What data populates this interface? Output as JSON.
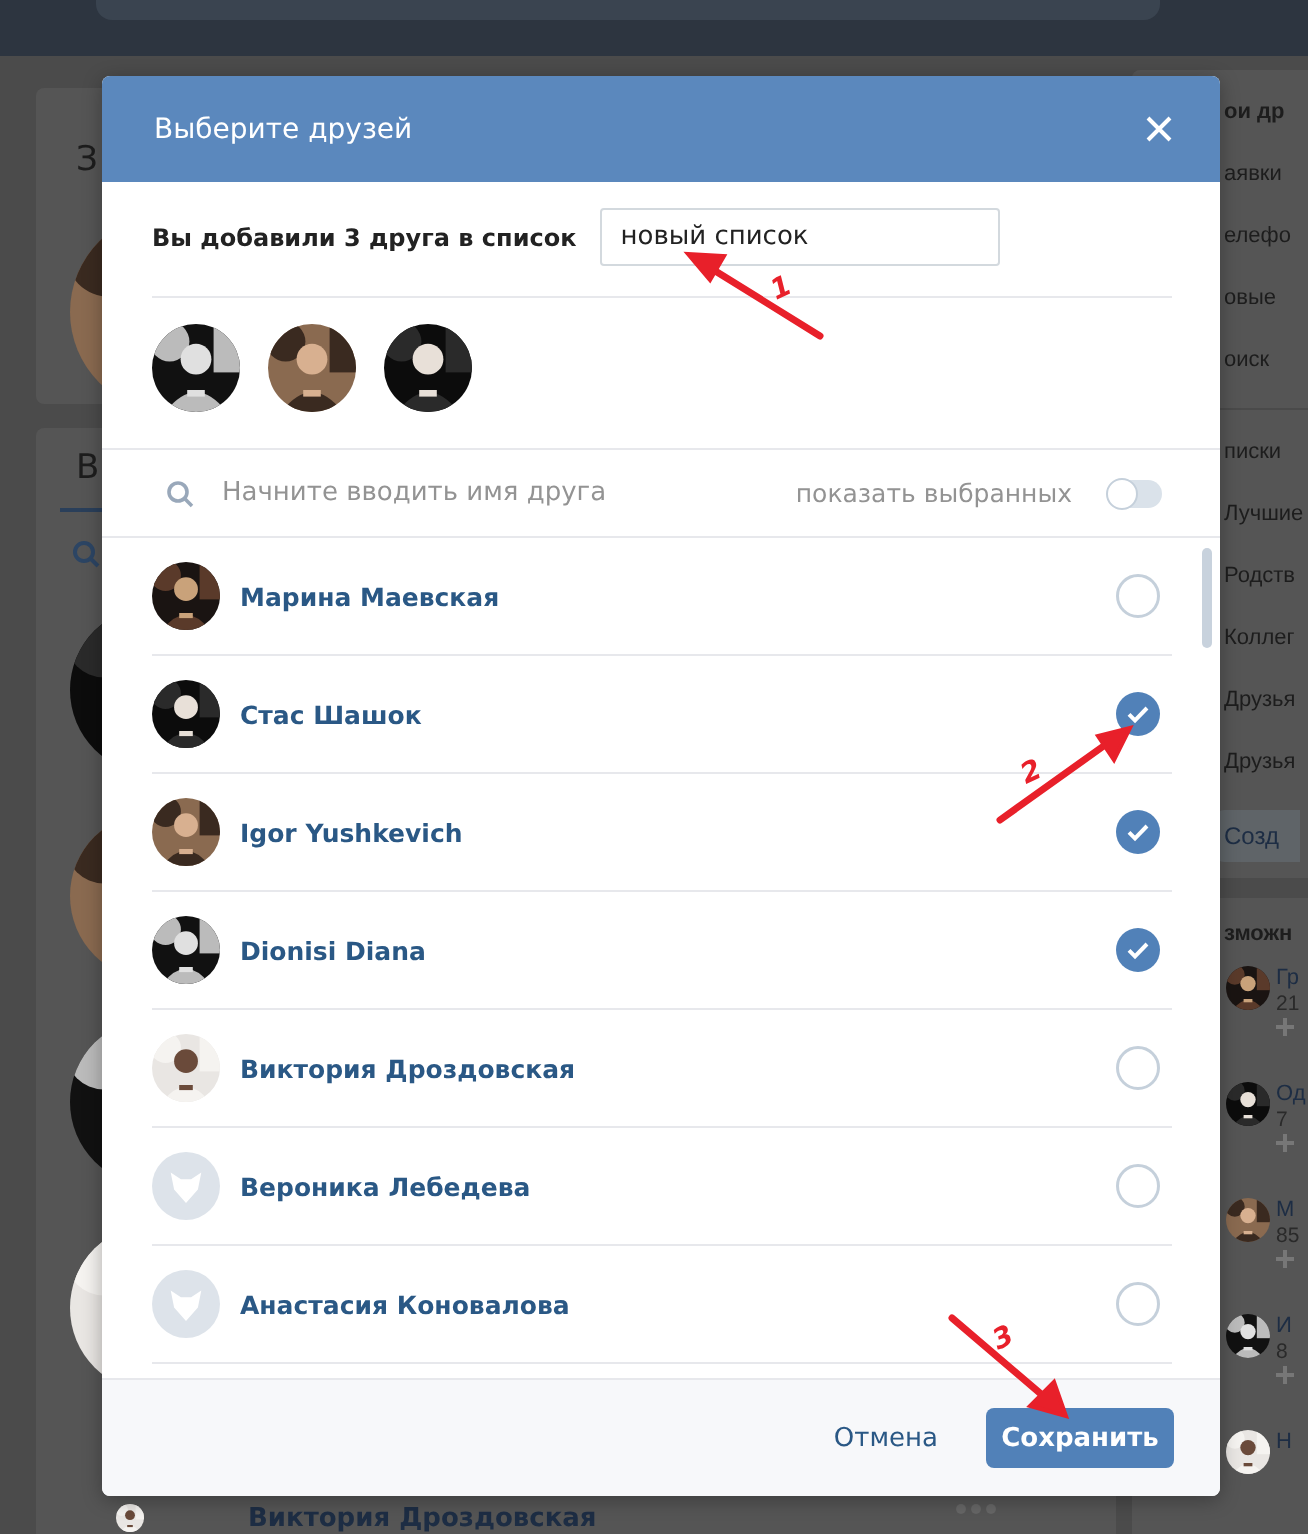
{
  "page": {
    "left_cards": [
      {
        "title": "З"
      },
      {
        "title": "В"
      }
    ],
    "right_menu": {
      "items": [
        {
          "label": "ои др",
          "selected": true
        },
        {
          "label": "аявки",
          "selected": false
        },
        {
          "label": "елефо",
          "selected": false
        },
        {
          "label": "овые",
          "selected": false
        },
        {
          "label": "оиск",
          "selected": false
        }
      ],
      "lists": [
        "писки",
        "Лучшие",
        "Родств",
        "Коллег",
        "Друзья",
        "Друзья"
      ],
      "create_button": "Созд"
    },
    "suggestions": {
      "title": "зможн",
      "people": [
        {
          "name": "Гр",
          "info": "21"
        },
        {
          "name": "Од",
          "info": "7"
        },
        {
          "name": "М",
          "info": "85"
        },
        {
          "name": "И",
          "info": "8"
        },
        {
          "name": "Н"
        }
      ]
    },
    "bottom_row": {
      "name": "Виктория Дроздовская"
    }
  },
  "modal": {
    "title": "Выберите друзей",
    "summary": "Вы добавили 3 друга в список",
    "list_name": "новый список",
    "search": {
      "placeholder": "Начните вводить имя друга"
    },
    "show_selected": {
      "label": "показать выбранных",
      "on": false
    },
    "friends": [
      {
        "name": "Марина Маевская",
        "selected": false
      },
      {
        "name": "Стас Шашок",
        "selected": true
      },
      {
        "name": "Igor Yushkevich",
        "selected": true
      },
      {
        "name": "Dionisi Diana",
        "selected": true
      },
      {
        "name": "Виктория Дроздовская",
        "selected": false
      },
      {
        "name": "Вероника Лебедева",
        "kind": "default",
        "selected": false
      },
      {
        "name": "Анастасия Коновалова",
        "kind": "default",
        "selected": false
      }
    ],
    "cancel": "Отмена",
    "save": "Сохранить"
  },
  "annotations": [
    {
      "label": "1"
    },
    {
      "label": "2"
    },
    {
      "label": "3"
    }
  ]
}
